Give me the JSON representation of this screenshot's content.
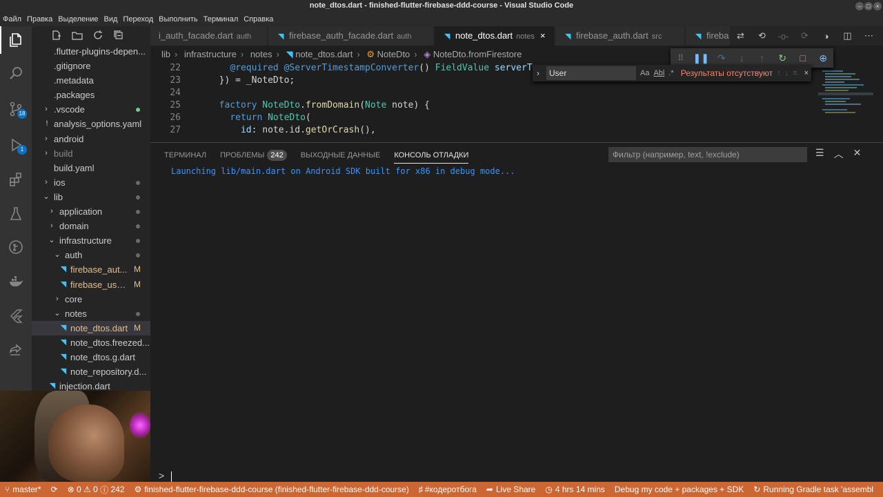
{
  "window": {
    "title": "note_dtos.dart - finished-flutter-firebase-ddd-course - Visual Studio Code"
  },
  "menu": [
    "Файл",
    "Правка",
    "Выделение",
    "Вид",
    "Переход",
    "Выполнить",
    "Терминал",
    "Справка"
  ],
  "activity": {
    "source_control_badge": "18",
    "debug_badge": "1"
  },
  "explorer": {
    "items": [
      {
        "label": ".flutter-plugins-depen...",
        "icon": ""
      },
      {
        "label": ".gitignore",
        "icon": ""
      },
      {
        "label": ".metadata",
        "icon": ""
      },
      {
        "label": ".packages",
        "icon": ""
      },
      {
        "label": ".vscode",
        "icon": ""
      },
      {
        "label": "analysis_options.yaml",
        "icon": "!"
      },
      {
        "label": "android",
        "icon": ""
      },
      {
        "label": "build",
        "icon": ""
      },
      {
        "label": "build.yaml",
        "icon": ""
      },
      {
        "label": "ios",
        "icon": ""
      },
      {
        "label": "lib",
        "icon": ""
      },
      {
        "label": "application",
        "icon": ""
      },
      {
        "label": "domain",
        "icon": ""
      },
      {
        "label": "infrastructure",
        "icon": ""
      },
      {
        "label": "auth",
        "icon": ""
      },
      {
        "label": "firebase_aut...",
        "icon": "",
        "modified": "M"
      },
      {
        "label": "firebase_use...",
        "icon": "",
        "modified": "M"
      },
      {
        "label": "core",
        "icon": ""
      },
      {
        "label": "notes",
        "icon": ""
      },
      {
        "label": "note_dtos.dart",
        "icon": "",
        "modified": "M"
      },
      {
        "label": "note_dtos.freezed...",
        "icon": ""
      },
      {
        "label": "note_dtos.g.dart",
        "icon": ""
      },
      {
        "label": "note_repository.d...",
        "icon": ""
      },
      {
        "label": "injection.dart",
        "icon": ""
      }
    ]
  },
  "tabs": [
    {
      "label": "i_auth_facade.dart",
      "path": "auth"
    },
    {
      "label": "firebase_auth_facade.dart",
      "path": "auth"
    },
    {
      "label": "note_dtos.dart",
      "path": "notes"
    },
    {
      "label": "firebase_auth.dart",
      "path": "src"
    },
    {
      "label": "fireba",
      "path": ""
    }
  ],
  "breadcrumb": [
    "lib",
    "infrastructure",
    "notes",
    "note_dtos.dart",
    "NoteDto",
    "NoteDto.fromFirestore"
  ],
  "code": {
    "line_numbers": [
      "22",
      "23",
      "24",
      "25",
      "26",
      "27"
    ],
    "l22_a": "@required",
    "l22_b": "@ServerTimestampConverter",
    "l22_c": "() ",
    "l22_d": "FieldValue",
    "l22_e": " serverT",
    "l23": "}) = _NoteDto;",
    "l25_a": "factory",
    "l25_b": "NoteDto",
    "l25_c": ".",
    "l25_d": "fromDomain",
    "l25_e": "(",
    "l25_f": "Note",
    "l25_g": " note) {",
    "l26_a": "return",
    "l26_b": "NoteDto",
    "l26_c": "(",
    "l27_a": "id",
    "l27_b": ": note.id.",
    "l27_c": "getOrCrash",
    "l27_d": "(),"
  },
  "find": {
    "value": "User",
    "no_results": "Результаты отсутствуют",
    "opt_case": "Aa",
    "opt_word": "Abl",
    "opt_regex": ".*"
  },
  "panel": {
    "tabs": [
      "ТЕРМИНАЛ",
      "ПРОБЛЕМЫ",
      "ВЫХОДНЫЕ ДАННЫЕ",
      "КОНСОЛЬ ОТЛАДКИ"
    ],
    "problems_count": "242",
    "filter_placeholder": "Фильтр (например, text, !exclude)",
    "output": "Launching lib/main.dart on Android SDK built for x86 in debug mode...",
    "prompt": ">"
  },
  "status": {
    "branch": "master*",
    "errors": "0",
    "warnings": "0",
    "infos": "242",
    "project": "finished-flutter-firebase-ddd-course (finished-flutter-firebase-ddd-course)",
    "tag": "#кодеротбога",
    "live_share": "Live Share",
    "time": "4 hrs 14 mins",
    "debug_config": "Debug my code + packages + SDK",
    "gradle": "Running Gradle task 'assembl"
  },
  "colors": {
    "status_bar": "#cc6633",
    "dart_icon": "#40c4ff",
    "no_results": "#f48771",
    "console_text": "#3794ff"
  }
}
